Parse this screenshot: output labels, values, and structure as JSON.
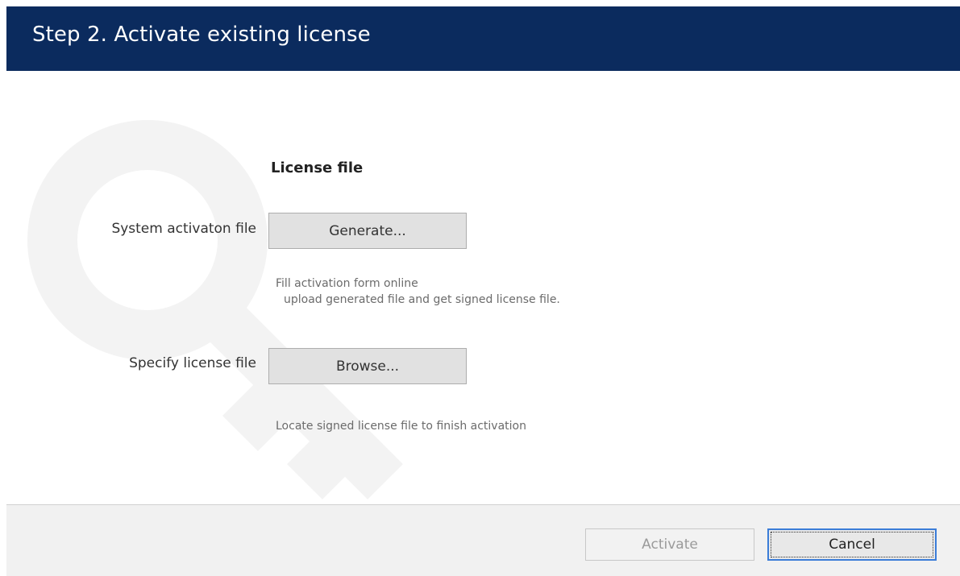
{
  "header": {
    "title": "Step 2. Activate existing license"
  },
  "license": {
    "section_title": "License file",
    "system_file_label": "System activaton file",
    "generate_label": "Generate...",
    "generate_hint_line1": "Fill activation form online",
    "generate_hint_line2": "upload generated file and get signed license file.",
    "specify_label": "Specify license file",
    "browse_label": "Browse...",
    "browse_hint": "Locate signed license file to finish activation"
  },
  "footer": {
    "activate_label": "Activate",
    "cancel_label": "Cancel"
  },
  "colors": {
    "header_bg": "#0b2b5e",
    "button_bg": "#e1e1e1",
    "focus_border": "#3b7dd8",
    "footer_bg": "#f1f1f1"
  },
  "icons": {
    "watermark": "key-icon"
  }
}
